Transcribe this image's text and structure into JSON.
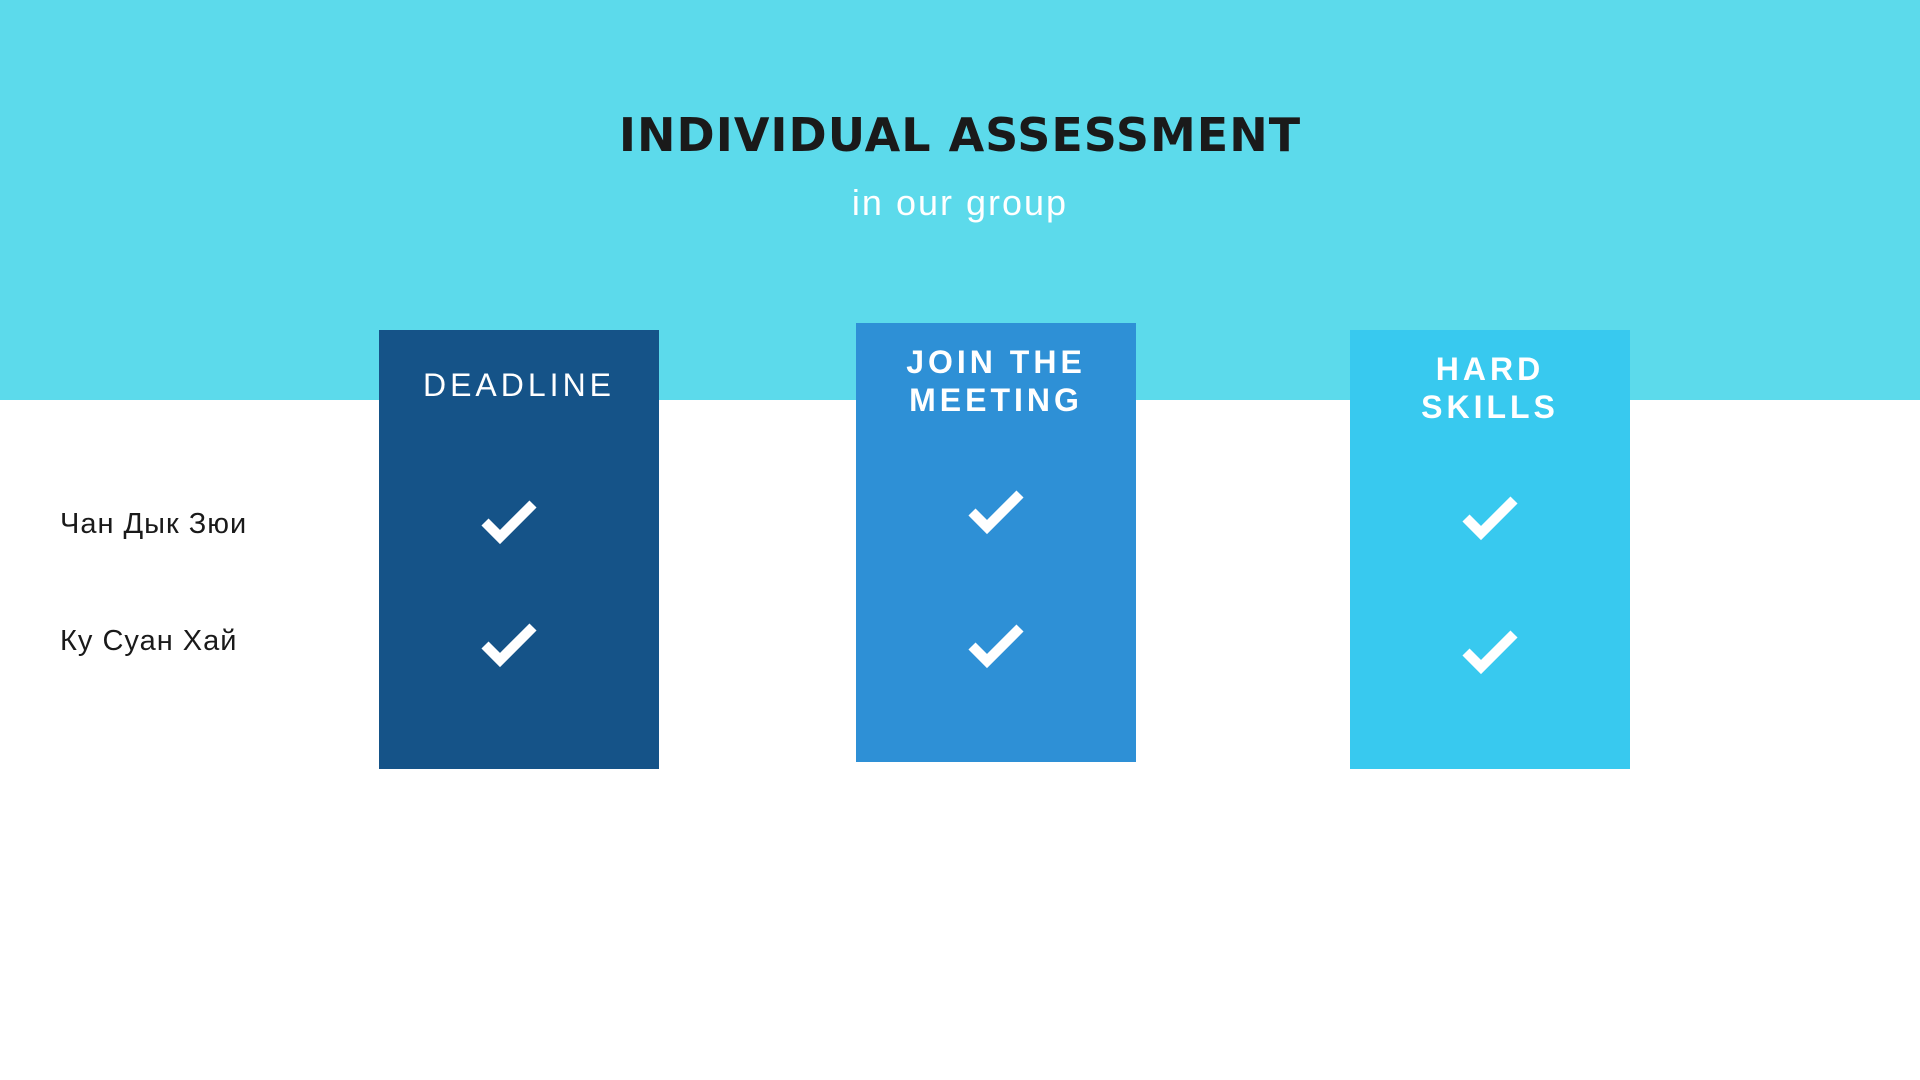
{
  "slide": {
    "title": "INDIVIDUAL ASSESSMENT",
    "subtitle": "in our group"
  },
  "columns": [
    {
      "label": "DEADLINE",
      "color": "#155388",
      "checks": [
        "check-icon",
        "check-icon"
      ]
    },
    {
      "label": "JOIN THE\nMEETING",
      "color": "#2e90d6",
      "checks": [
        "check-icon",
        "check-icon"
      ]
    },
    {
      "label": "HARD\nSKILLS",
      "color": "#38c9ef",
      "checks": [
        "check-icon",
        "check-icon"
      ]
    }
  ],
  "members": [
    {
      "name": "Чан Дык Зюи"
    },
    {
      "name": "Ку Суан Хай"
    }
  ],
  "colors": {
    "header_band": "#5cdaeb",
    "background": "#ffffff",
    "title_text": "#1a1a1a",
    "subtitle_text": "#ffffff",
    "check": "#ffffff"
  }
}
